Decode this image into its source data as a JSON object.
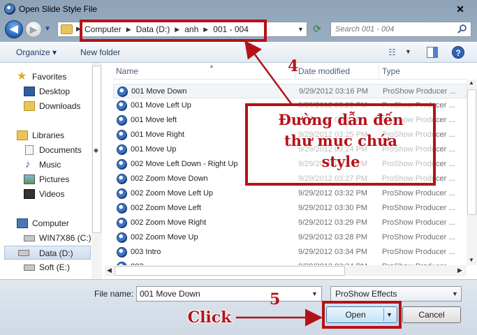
{
  "window": {
    "title": "Open Slide Style File",
    "close_glyph": "✕"
  },
  "nav": {
    "back_glyph": "◀",
    "forward_glyph": "▶",
    "breadcrumbs": [
      "Computer",
      "Data (D:)",
      "anh",
      "001 - 004"
    ],
    "search_placeholder": "Search 001 - 004"
  },
  "toolbar": {
    "organize_label": "Organize ▾",
    "new_folder_label": "New folder"
  },
  "sidebar": {
    "items": [
      {
        "label": "Favorites",
        "icon": "star-icon",
        "group": true
      },
      {
        "label": "Desktop",
        "icon": "desktop-icon"
      },
      {
        "label": "Downloads",
        "icon": "downloads-folder-icon"
      },
      {
        "label": "Libraries",
        "icon": "libraries-icon",
        "group": true
      },
      {
        "label": "Documents",
        "icon": "documents-icon"
      },
      {
        "label": "Music",
        "icon": "music-icon"
      },
      {
        "label": "Pictures",
        "icon": "pictures-icon"
      },
      {
        "label": "Videos",
        "icon": "videos-icon"
      },
      {
        "label": "Computer",
        "icon": "computer-icon",
        "group": true
      },
      {
        "label": "WIN7X86 (C:)",
        "icon": "drive-icon"
      },
      {
        "label": "Data (D:)",
        "icon": "drive-icon",
        "selected": true
      },
      {
        "label": "Soft (E:)",
        "icon": "drive-icon"
      }
    ]
  },
  "file_list": {
    "columns": {
      "name": "Name",
      "date": "Date modified",
      "type": "Type"
    },
    "rows": [
      {
        "name": "001 Move Down",
        "date": "9/29/2012 03:16 PM",
        "type": "ProShow Producer ...",
        "selected": true
      },
      {
        "name": "001 Move Left Up",
        "date": "9/29/2012 03:29 PM",
        "type": "ProShow Producer ..."
      },
      {
        "name": "001 Move left",
        "date": "9/29/2012 03:19 PM",
        "type": "ProShow Producer ..."
      },
      {
        "name": "001 Move Right",
        "date": "9/29/2012 03:25 PM",
        "type": "ProShow Producer ..."
      },
      {
        "name": "001 Move Up",
        "date": "9/29/2012 03:24 PM",
        "type": "ProShow Producer ..."
      },
      {
        "name": "002 Move Left Down - Right Up",
        "date": "9/29/2012 03:32 PM",
        "type": "ProShow Producer ..."
      },
      {
        "name": "002 Zoom Move Down",
        "date": "9/29/2012 03:27 PM",
        "type": "ProShow Producer ..."
      },
      {
        "name": "002 Zoom Move Left Up",
        "date": "9/29/2012 03:32 PM",
        "type": "ProShow Producer ..."
      },
      {
        "name": "002 Zoom Move Left",
        "date": "9/29/2012 03:30 PM",
        "type": "ProShow Producer ..."
      },
      {
        "name": "002 Zoom Move Right",
        "date": "9/29/2012 03:29 PM",
        "type": "ProShow Producer ..."
      },
      {
        "name": "002 Zoom Move Up",
        "date": "9/29/2012 03:28 PM",
        "type": "ProShow Producer ..."
      },
      {
        "name": "003 Intro",
        "date": "9/29/2012 03:34 PM",
        "type": "ProShow Producer ..."
      },
      {
        "name": "003 ...",
        "date": "9/29/2012 03:34 PM",
        "type": "ProShow Producer ..."
      }
    ]
  },
  "bottom": {
    "file_name_label": "File name:",
    "file_name_value": "001 Move Down",
    "file_type_value": "ProShow Effects",
    "open_label": "Open",
    "cancel_label": "Cancel"
  },
  "annotations": {
    "step4_number": "4",
    "step4_text_line1": "Đường dẫn đến",
    "step4_text_line2": "thư mục chứa",
    "step4_text_line3": "style",
    "step5_number": "5",
    "click_label": "Click",
    "color": "#b51218"
  }
}
